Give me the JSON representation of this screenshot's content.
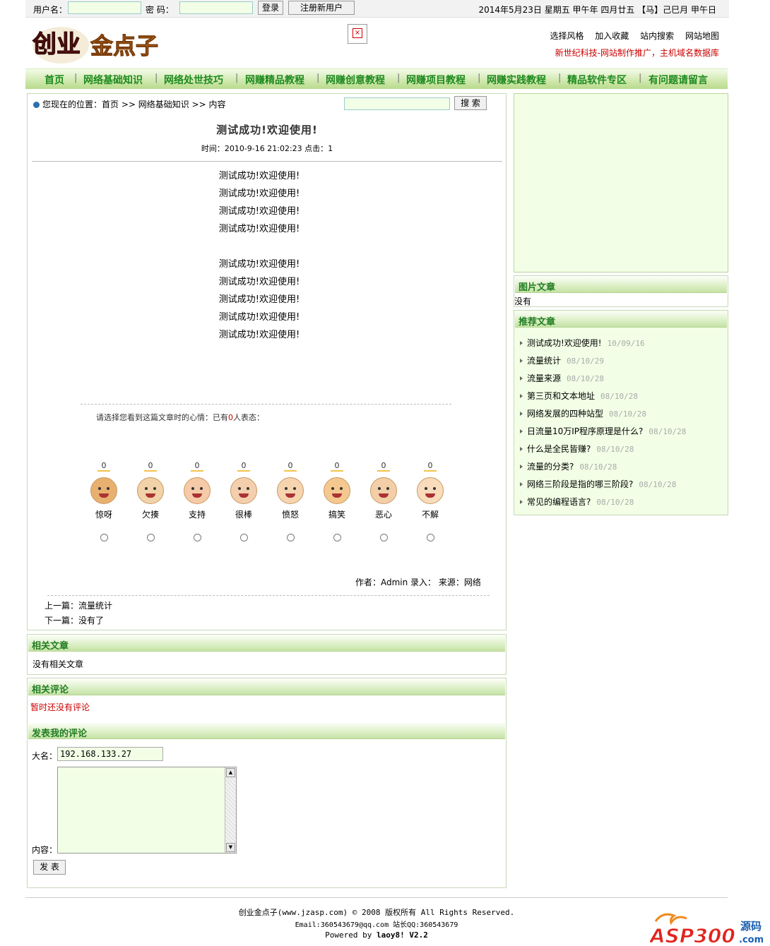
{
  "login": {
    "username_label": "用户名：",
    "password_label": "密  码：",
    "login_button": "登录",
    "register_button": "注册新用户"
  },
  "date_text": "2014年5月23日 星期五  甲午年 四月廿五 【马】己巳月 甲午日",
  "logo": {
    "text_left": "创业",
    "text_right": "金点子"
  },
  "top_links": [
    "选择风格",
    "加入收藏",
    "站内搜索",
    "网站地图"
  ],
  "slogan": "新世纪科技-网站制作推广，主机域名数据库",
  "nav": [
    "首页",
    "网络基础知识",
    "网络处世技巧",
    "网赚精品教程",
    "网赚创意教程",
    "网赚项目教程",
    "网赚实践教程",
    "精品软件专区",
    "有问题请留言"
  ],
  "breadcrumb": "您现在的位置：首页 >> 网络基础知识 >> 内容",
  "search_button": "搜 索",
  "article": {
    "title": "测试成功!欢迎使用!",
    "meta": "时间：2010-9-16 21:02:23 点击：1",
    "lines": [
      "测试成功!欢迎使用!",
      "测试成功!欢迎使用!",
      "测试成功!欢迎使用!",
      "测试成功!欢迎使用!",
      "",
      "测试成功!欢迎使用!",
      "测试成功!欢迎使用!",
      "测试成功!欢迎使用!",
      "测试成功!欢迎使用!",
      "测试成功!欢迎使用!"
    ]
  },
  "mood": {
    "prompt_before": "请选择您看到这篇文章时的心情：已有",
    "prompt_count": "0",
    "prompt_after": "人表态：",
    "items": [
      {
        "name": "惊呀",
        "count": "0",
        "color": "#e8b070"
      },
      {
        "name": "欠揍",
        "count": "0",
        "color": "#f2d2a8"
      },
      {
        "name": "支持",
        "count": "0",
        "color": "#f6caa8"
      },
      {
        "name": "很棒",
        "count": "0",
        "color": "#f4cfae"
      },
      {
        "name": "愤怒",
        "count": "0",
        "color": "#f7d4b0"
      },
      {
        "name": "搞笑",
        "count": "0",
        "color": "#f5c890"
      },
      {
        "name": "恶心",
        "count": "0",
        "color": "#f2cfa9"
      },
      {
        "name": "不解",
        "count": "0",
        "color": "#f8dcbc"
      }
    ]
  },
  "author_line": "作者：Admin 录入： 来源：网络",
  "prev_label": "上一篇：",
  "prev_link": "流量统计",
  "next_label": "下一篇：",
  "next_value": "没有了",
  "related": {
    "title": "相关文章",
    "empty": "没有相关文章"
  },
  "comments": {
    "title": "相关评论",
    "empty": "暂时还没有评论"
  },
  "post_comment": {
    "title": "发表我的评论",
    "name_label": "大名：",
    "name_value": "192.168.133.27",
    "content_label": "内容：",
    "submit": "发 表"
  },
  "picture_articles": {
    "title": "图片文章",
    "empty": "没有"
  },
  "recommended": {
    "title": "推荐文章",
    "items": [
      {
        "title": "测试成功!欢迎使用!",
        "date": "10/09/16"
      },
      {
        "title": "流量统计",
        "date": "08/10/29"
      },
      {
        "title": "流量来源",
        "date": "08/10/28"
      },
      {
        "title": "第三页和文本地址",
        "date": "08/10/28"
      },
      {
        "title": "网络发展的四种站型",
        "date": "08/10/28"
      },
      {
        "title": "日流量10万IP程序原理是什么?",
        "date": "08/10/28"
      },
      {
        "title": "什么是全民皆赚?",
        "date": "08/10/28"
      },
      {
        "title": "流量的分类?",
        "date": "08/10/28"
      },
      {
        "title": "网络三阶段是指的哪三阶段?",
        "date": "08/10/28"
      },
      {
        "title": "常见的编程语言?",
        "date": "08/10/28"
      }
    ]
  },
  "footer": {
    "line1": "创业金点子(www.jzasp.com) © 2008 版权所有 All Rights Reserved.",
    "line2": "Email:360543679@qq.com 站长QQ:360543679",
    "line3_prefix": "Powered by ",
    "line3_bold": "laoy8! V2.2"
  },
  "watermark": {
    "text": "ASP300",
    "suffix": "源码",
    "domain": ".com"
  },
  "colors": {
    "nav_text": "#1e8a1e",
    "section_title": "#227d22",
    "alert_red": "#cc0000",
    "input_bg": "#f2ffe6"
  }
}
